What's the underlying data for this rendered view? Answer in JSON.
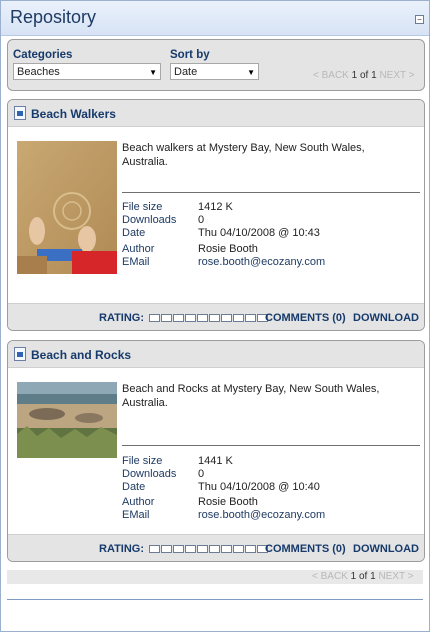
{
  "window": {
    "title": "Repository"
  },
  "filters": {
    "categories_label": "Categories",
    "categories_value": "Beaches",
    "sortby_label": "Sort by",
    "sortby_value": "Date"
  },
  "pager": {
    "back": "< BACK",
    "current": "1 of 1",
    "next": "NEXT >"
  },
  "items": [
    {
      "title": "Beach Walkers",
      "description": "Beach walkers at Mystery Bay, New South Wales, Australia.",
      "file_size_label": "File size",
      "file_size": "1412 K",
      "downloads_label": "Downloads",
      "downloads": "0",
      "date_label": "Date",
      "date": "Thu 04/10/2008 @ 10:43",
      "author_label": "Author",
      "author": "Rosie Booth",
      "email_label": "EMail",
      "email": "rose.booth@ecozany.com",
      "rating_label": "RATING:",
      "rating_value": 0,
      "rating_max": 10,
      "comments": "COMMENTS (0)",
      "download": "DOWNLOAD"
    },
    {
      "title": "Beach and Rocks",
      "description": "Beach and Rocks at Mystery Bay, New South Wales, Australia.",
      "file_size_label": "File size",
      "file_size": "1441 K",
      "downloads_label": "Downloads",
      "downloads": "0",
      "date_label": "Date",
      "date": "Thu 04/10/2008 @ 10:40",
      "author_label": "Author",
      "author": "Rosie Booth",
      "email_label": "EMail",
      "email": "rose.booth@ecozany.com",
      "rating_label": "RATING:",
      "rating_value": 0,
      "rating_max": 10,
      "comments": "COMMENTS (0)",
      "download": "DOWNLOAD"
    }
  ],
  "icons": {
    "file": "document-icon",
    "minimize": "minimize-icon",
    "dropdown": "chevron-down-icon"
  }
}
